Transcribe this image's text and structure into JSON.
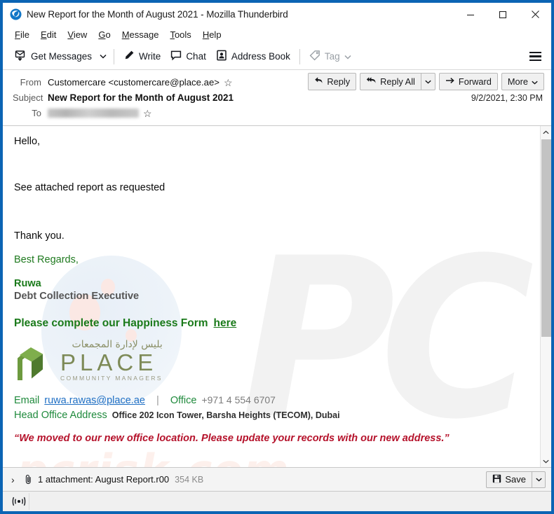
{
  "window": {
    "title": "New Report for the Month of August 2021 - Mozilla Thunderbird",
    "app_icon": "thunderbird-icon",
    "minimize_label": "–",
    "maximize_label": "☐",
    "close_label": "✕"
  },
  "menubar": {
    "items": [
      {
        "first": "F",
        "rest": "ile"
      },
      {
        "first": "E",
        "rest": "dit"
      },
      {
        "first": "V",
        "rest": "iew"
      },
      {
        "first": "G",
        "rest": "o"
      },
      {
        "first": "M",
        "rest": "essage"
      },
      {
        "first": "T",
        "rest": "ools"
      },
      {
        "first": "H",
        "rest": "elp"
      }
    ]
  },
  "toolbar": {
    "get_messages": "Get Messages",
    "write": "Write",
    "chat": "Chat",
    "address_book": "Address Book",
    "tag": "Tag",
    "menu_icon": "hamburger-icon"
  },
  "message_header": {
    "from_label": "From",
    "from_value": "Customercare <customercare@place.ae>",
    "subject_label": "Subject",
    "subject_value": "New Report for the Month of August 2021",
    "to_label": "To",
    "to_value": "",
    "date": "9/2/2021, 2:30 PM",
    "star_glyph": "☆",
    "actions": {
      "reply": "Reply",
      "reply_all": "Reply All",
      "forward": "Forward",
      "more": "More",
      "caret_glyph": "⌄"
    }
  },
  "body": {
    "greeting": "Hello,",
    "line1": "See attached report as requested",
    "thanks": "Thank you.",
    "regards": "Best Regards,",
    "sender_name": "Ruwa",
    "sender_title": "Debt Collection Executive",
    "happiness_text": "Please complete our Happiness Form",
    "happiness_link": "here",
    "logo": {
      "arabic": "بليس لإدارة المجمعات",
      "name": "PLACE",
      "tagline": "COMMUNITY MANAGERS"
    },
    "contact": {
      "email_label": "Email",
      "email_value": "ruwa.rawas@place.ae",
      "separator": "|",
      "office_label": "Office",
      "office_value": "+971 4 554 6707",
      "address_label": "Head Office Address",
      "address_value": "Office 202 Icon Tower, Barsha Heights (TECOM), Dubai"
    },
    "quote": "“We moved to our new office location.  Please update your records with our new address.”",
    "watermark_logo": "PC",
    "watermark_text": "pcrisk.com"
  },
  "attachment_bar": {
    "expand_glyph": "›",
    "clip_icon": "paperclip-icon",
    "text": "1 attachment: August Report.r00",
    "size": "354 KB",
    "save_label": "Save",
    "save_caret": "⌄"
  },
  "statusbar": {
    "online_icon": "online-status-icon"
  },
  "colors": {
    "window_border": "#0b64b4",
    "green": "#1a7a1a",
    "link_blue": "#1f6fc4",
    "quote_red": "#b5122b",
    "logo_green": "#7d8a57"
  }
}
